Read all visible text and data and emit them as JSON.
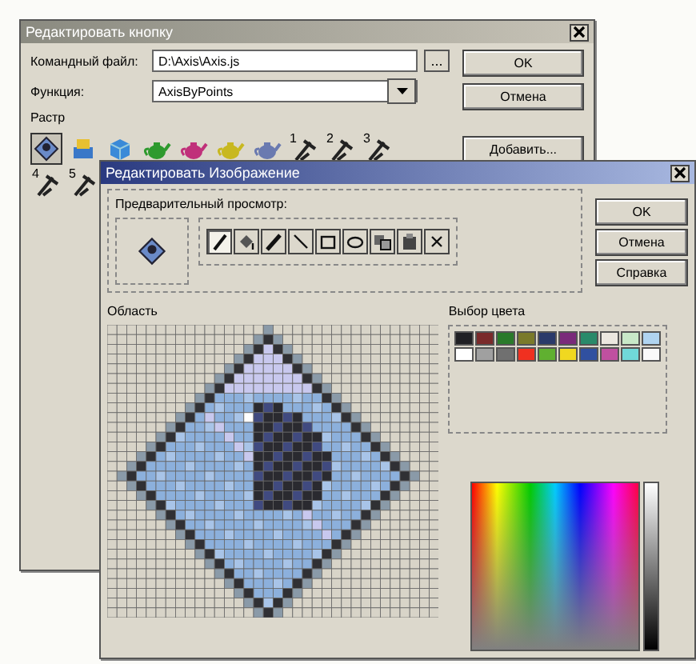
{
  "back_window": {
    "title": "Редактировать кнопку",
    "active": false,
    "fields": [
      {
        "kind": "browse",
        "label": "Командный файл:",
        "value": "D:\\Axis\\Axis.js",
        "button": "..."
      },
      {
        "kind": "dropdown",
        "label": "Функция:",
        "value": "AxisByPoints"
      }
    ],
    "buttons": [
      "OK",
      "Отмена",
      "Добавить..."
    ],
    "raster_label": "Растр",
    "raster_icons": [
      {
        "kind": "select",
        "selected": true
      },
      {
        "kind": "box",
        "selected": false
      },
      {
        "kind": "cube",
        "selected": false
      },
      {
        "kind": "teapot",
        "color": "#2e9a2e",
        "selected": false
      },
      {
        "kind": "teapot",
        "color": "#c0307a",
        "selected": false
      },
      {
        "kind": "teapot",
        "color": "#c8b820",
        "selected": false
      },
      {
        "kind": "teapot",
        "color": "#6a7ab0",
        "selected": false
      },
      {
        "kind": "tool",
        "number": "1",
        "selected": false
      },
      {
        "kind": "tool",
        "number": "2",
        "selected": false
      },
      {
        "kind": "tool",
        "number": "3",
        "selected": false
      },
      {
        "kind": "tool",
        "number": "4",
        "selected": false
      },
      {
        "kind": "tool",
        "number": "5",
        "selected": false
      }
    ]
  },
  "front_window": {
    "title": "Редактировать Изображение",
    "active": true,
    "preview_label": "Предварительный просмотр:",
    "tools": [
      {
        "kind": "pencil",
        "selected": true
      },
      {
        "kind": "fill",
        "selected": false
      },
      {
        "kind": "brush",
        "selected": false
      },
      {
        "kind": "line",
        "selected": false
      },
      {
        "kind": "rect",
        "selected": false
      },
      {
        "kind": "ellipse",
        "selected": false
      },
      {
        "kind": "copy",
        "selected": false
      },
      {
        "kind": "paste",
        "selected": false
      },
      {
        "kind": "clear",
        "selected": false
      }
    ],
    "buttons": [
      "OK",
      "Отмена",
      "Справка"
    ],
    "area_label": "Область",
    "color_label": "Выбор цвета",
    "palette": [
      {
        "color": "#202024"
      },
      {
        "color": "#7a2a2a"
      },
      {
        "color": "#2a7a2a"
      },
      {
        "color": "#7a7a2a"
      },
      {
        "color": "#2a3a6a"
      },
      {
        "color": "#7a2a7a"
      },
      {
        "color": "#2a8a6a"
      },
      {
        "color": "#ece8e0"
      },
      {
        "color": "#c8e8c8"
      },
      {
        "color": "#b0d4f0"
      },
      {
        "color": "#ffffff"
      },
      {
        "color": "#a0a0a0"
      },
      {
        "color": "#707070"
      },
      {
        "color": "#f03020"
      },
      {
        "color": "#60b030"
      },
      {
        "color": "#f0d820"
      },
      {
        "color": "#3050a0"
      },
      {
        "color": "#c050a0"
      },
      {
        "color": "#70d8d8"
      },
      {
        "color": "#fafafa"
      }
    ]
  }
}
